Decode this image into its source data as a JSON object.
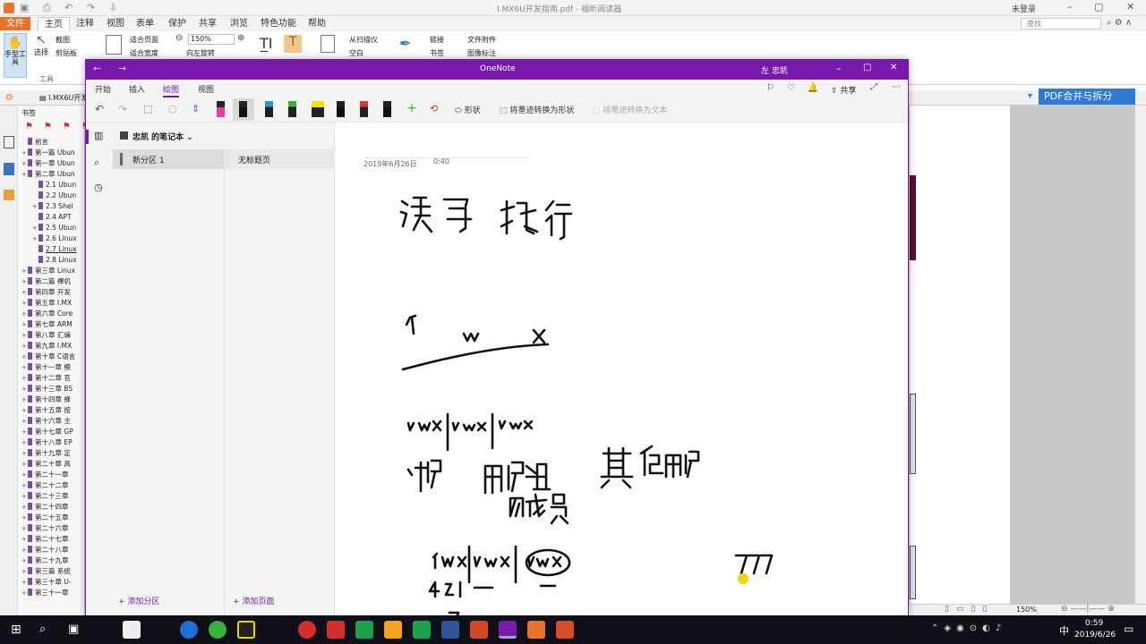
{
  "foxit": {
    "title": "I.MX6U开发指南.pdf - 福昕阅读器",
    "login": "未登录",
    "search_placeholder": "查找",
    "tabs": [
      "文件",
      "主页",
      "注释",
      "视图",
      "表单",
      "保护",
      "共享",
      "浏览",
      "特色功能",
      "帮助"
    ],
    "ribbon": {
      "hand_tool": "手型工具",
      "select": "选择",
      "screenshot": "截图",
      "clipboard": "剪贴板",
      "fit_page": "适合页面",
      "fit_width": "适合宽度",
      "zoom": "150%",
      "rotate_left": "向左旋转",
      "from_scanner": "从扫描仪",
      "blank": "空白",
      "link": "链接",
      "bookmark": "书签",
      "file_attachment": "文件附件",
      "image_annotation": "图像标注",
      "tools_group": "工具"
    },
    "doc_tab": "I.MX6U开发",
    "bookmarks_title": "书签",
    "pdf_merge": "PDF合并与拆分",
    "bookmarks": [
      "前言",
      "第一篇 Ubun",
      "第一章 Ubun",
      "第二章 Ubun",
      "2.1 Ubun",
      "2.2 Ubun",
      "2.3 Shel",
      "2.4 APT",
      "2.5 Ubun",
      "2.6 Linux",
      "2.7 Linux",
      "2.8 Linux",
      "第三章 Linux",
      "第二篇 裸机",
      "第四章 开发",
      "第五章 I.MX",
      "第六章 Core",
      "第七章 ARM",
      "第八章 汇编",
      "第九章 I.MX",
      "第十章 C语言",
      "第十一章 模",
      "第十二章 官",
      "第十三章 BS",
      "第十四章 蜂",
      "第十五章 按",
      "第十六章 主",
      "第十七章 GP",
      "第十八章 EP",
      "第十九章 定",
      "第二十章 高",
      "第二十一章",
      "第二十二章",
      "第二十三章",
      "第二十四章",
      "第二十五章",
      "第二十六章",
      "第二十七章",
      "第二十八章",
      "第二十九章",
      "第三篇 系统",
      "第三十章 U-",
      "第三十一章"
    ],
    "status_zoom": "150%"
  },
  "onenote": {
    "title": "OneNote",
    "user": "左 忠凯",
    "share": "共享",
    "tabs": [
      "开始",
      "插入",
      "绘图",
      "视图"
    ],
    "tools": {
      "shapes": "形状",
      "ink_to_shape": "将墨迹转换为形状",
      "ink_to_text": "将墨迹转换为文本"
    },
    "notebook": "忠凯 的笔记本",
    "section": "新分区 1",
    "page": "无标题页",
    "add_section": "添加分区",
    "add_page": "添加页面",
    "date": "2019年6月26日",
    "time": "0:40"
  },
  "taskbar": {
    "time": "0:59",
    "date": "2019/6/26",
    "lang": "中"
  },
  "colors": {
    "onenote_purple": "#7719aa",
    "foxit_orange": "#e8742c",
    "pdf_merge_blue": "#2e7bd6"
  }
}
